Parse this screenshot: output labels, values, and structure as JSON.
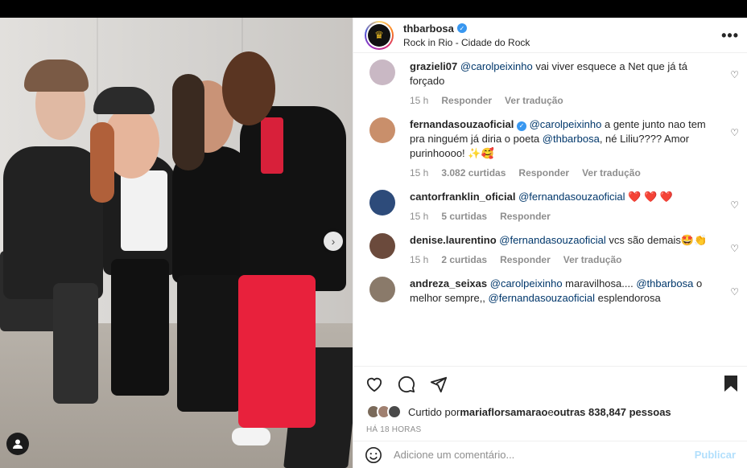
{
  "post": {
    "username": "thbarbosa",
    "location": "Rock in Rio - Cidade do Rock",
    "more_label": "•••"
  },
  "comments": [
    {
      "user": "grazieli07",
      "mention": "@carolpeixinho",
      "text": " vai viver esquece a Net que já tá forçado",
      "time": "15 h",
      "likes": "",
      "reply": "Responder",
      "translate": "Ver tradução",
      "avatar_color": "#c9b8c4"
    },
    {
      "user": "fernandasouzaoficial",
      "verified": true,
      "mention": "@carolpeixinho",
      "text1": " a gente junto nao tem pra ninguém já diria o poeta ",
      "mention2": "@thbarbosa",
      "text2": ", né Liliu???? Amor purinhoooo! ✨🥰",
      "time": "15 h",
      "likes": "3.082 curtidas",
      "reply": "Responder",
      "translate": "Ver tradução",
      "avatar_color": "#c98f6b"
    },
    {
      "user": "cantorfranklin_oficial",
      "mention": "@fernandasouzaoficial",
      "text": " ❤️ ❤️ ❤️",
      "time": "15 h",
      "likes": "5 curtidas",
      "reply": "Responder",
      "avatar_color": "#2d4b7a"
    },
    {
      "user": "denise.laurentino",
      "mention": "@fernandasouzaoficial",
      "text": " vcs são demais🤩👏",
      "time": "15 h",
      "likes": "2 curtidas",
      "reply": "Responder",
      "translate": "Ver tradução",
      "avatar_color": "#6b4a3c"
    },
    {
      "user": "andreza_seixas",
      "mention": "@carolpeixinho",
      "text1": " maravilhosa.... ",
      "mention2": "@thbarbosa",
      "text2": " o melhor sempre,, ",
      "mention3": "@fernandasouzaoficial",
      "text3": " esplendorosa",
      "avatar_color": "#8a7a6a"
    }
  ],
  "likes": {
    "prefix": "Curtido por ",
    "user": "mariaflorsamarao",
    "middle": " e ",
    "others": "outras 838,847 pessoas"
  },
  "time_ago": "HÁ 18 HORAS",
  "add_comment": {
    "placeholder": "Adicione um comentário...",
    "publish": "Publicar"
  },
  "colors": {
    "link": "#00376b",
    "muted": "#8e8e8e",
    "verified": "#3897f0",
    "publish_disabled": "#b2dffc"
  }
}
